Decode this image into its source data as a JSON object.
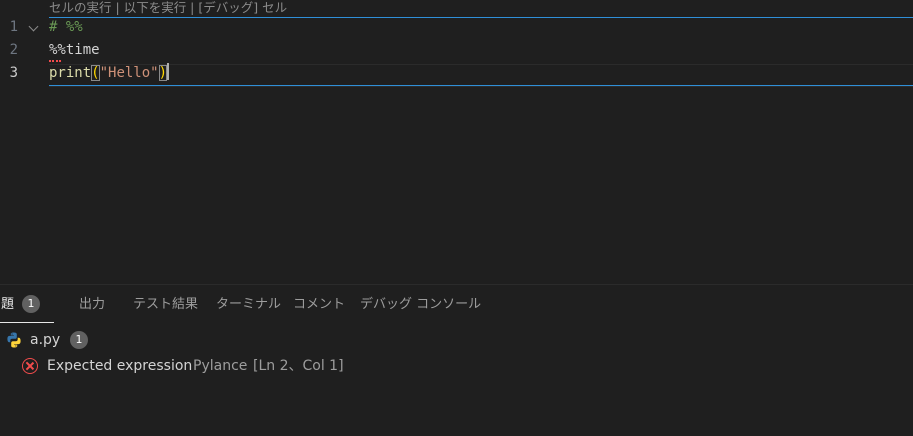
{
  "colors": {
    "background": "#1f1f1f",
    "cell_border": "#2f8fd8",
    "error": "#f14c4c",
    "badge": "#616161"
  },
  "editor": {
    "codelens": {
      "run_cell": "セルの実行",
      "sep1": " | ",
      "run_below": "以下を実行",
      "sep2": " | ",
      "debug_cell": "[デバッグ] セル"
    },
    "lines": [
      {
        "number": "1",
        "text": "# %%"
      },
      {
        "number": "2",
        "text": "%%time"
      },
      {
        "number": "3",
        "fn": "print",
        "open": "(",
        "str": "\"Hello\"",
        "close": ")"
      }
    ]
  },
  "panel": {
    "tabs": [
      {
        "label": "問題",
        "badge": "1",
        "active": true
      },
      {
        "label": "出力"
      },
      {
        "label": "テスト結果"
      },
      {
        "label": "ターミナル"
      },
      {
        "label": "コメント"
      },
      {
        "label": "デバッグ コンソール"
      }
    ],
    "file": {
      "name": "a.py",
      "count": "1",
      "icon": "python-icon"
    },
    "problems": [
      {
        "icon": "error-icon",
        "message": "Expected expression",
        "source": "Pylance",
        "location": "[Ln 2、Col 1]"
      }
    ]
  }
}
